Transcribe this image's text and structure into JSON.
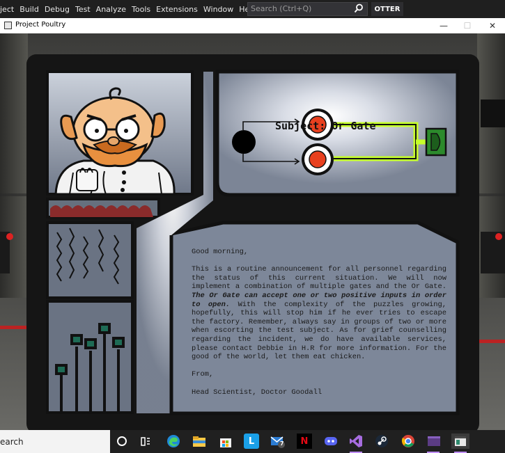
{
  "vs_menu": {
    "items": [
      "ject",
      "Build",
      "Debug",
      "Test",
      "Analyze",
      "Tools",
      "Extensions",
      "Window",
      "Help"
    ],
    "search_placeholder": "Search (Ctrl+Q)",
    "account": "OTTER"
  },
  "window": {
    "title": "Project Poultry",
    "minimize": "—",
    "maximize": "☐",
    "close": "✕"
  },
  "diagram": {
    "title": "Subject: Or Gate"
  },
  "letter": {
    "greeting": "Good morning,",
    "body_part1": "This is a routine announcement for all personnel regarding the status of this current situation. We will now implement a combination of multiple gates and the Or Gate. ",
    "body_emphasis": "The Or Gate can accept one or two positive inputs in order to open.",
    "body_part2": " With the complexity of the puzzles growing, hopefully, this will stop him if he ever tries to escape the factory. Remember, always say in groups of two or more when escorting the test subject. As for grief counselling regarding the incident, we do have available services, please contact Debbie in H.R for more information. For the good of the world, let them eat chicken.",
    "from": "From,",
    "signature": "Head Scientist, Doctor Goodall"
  },
  "taskbar": {
    "search_text": "earch",
    "badge_count": "7",
    "icons": [
      "task-view-icon",
      "widgets-icon",
      "edge-icon",
      "file-explorer-icon",
      "store-icon",
      "launcher-icon",
      "mail-icon",
      "netflix-icon",
      "discord-icon",
      "visual-studio-icon",
      "steam-icon",
      "chrome-icon",
      "terminal-icon",
      "game-window-icon"
    ]
  },
  "colors": {
    "accent_green": "#c6ff2a",
    "button_red": "#e8401f",
    "gate_green": "#2c8a2c",
    "vs_purple": "#c08dff"
  }
}
